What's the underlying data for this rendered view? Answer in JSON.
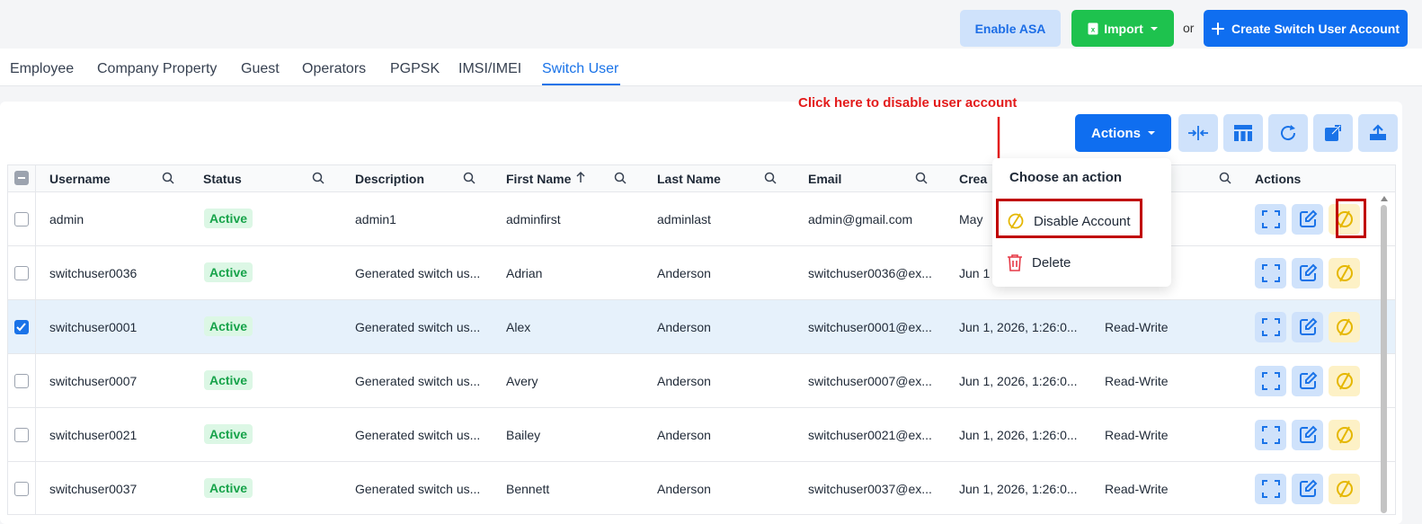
{
  "toolbar": {
    "enable_asa": "Enable ASA",
    "import": "Import",
    "or": "or",
    "create": "Create Switch User Account"
  },
  "tabs": [
    {
      "label": "Employee"
    },
    {
      "label": "Company Property"
    },
    {
      "label": "Guest"
    },
    {
      "label": "Operators"
    },
    {
      "label": "PGPSK"
    },
    {
      "label": "IMSI/IMEI"
    },
    {
      "label": "Switch User",
      "active": true
    }
  ],
  "annotation": "Click here to disable user account",
  "actions_button": "Actions",
  "table": {
    "columns": [
      "Username",
      "Status",
      "Description",
      "First Name",
      "Last Name",
      "Email",
      "Crea",
      "Actions"
    ],
    "rows": [
      {
        "username": "admin",
        "status": "Active",
        "description": "admin1",
        "first": "adminfirst",
        "last": "adminlast",
        "email": "admin@gmail.com",
        "created": "May",
        "role": "",
        "checked": false
      },
      {
        "username": "switchuser0036",
        "status": "Active",
        "description": "Generated switch us...",
        "first": "Adrian",
        "last": "Anderson",
        "email": "switchuser0036@ex...",
        "created": "Jun 1",
        "role": "",
        "checked": false
      },
      {
        "username": "switchuser0001",
        "status": "Active",
        "description": "Generated switch us...",
        "first": "Alex",
        "last": "Anderson",
        "email": "switchuser0001@ex...",
        "created": "Jun 1, 2026, 1:26:0...",
        "role": "Read-Write",
        "checked": true
      },
      {
        "username": "switchuser0007",
        "status": "Active",
        "description": "Generated switch us...",
        "first": "Avery",
        "last": "Anderson",
        "email": "switchuser0007@ex...",
        "created": "Jun 1, 2026, 1:26:0...",
        "role": "Read-Write",
        "checked": false
      },
      {
        "username": "switchuser0021",
        "status": "Active",
        "description": "Generated switch us...",
        "first": "Bailey",
        "last": "Anderson",
        "email": "switchuser0021@ex...",
        "created": "Jun 1, 2026, 1:26:0...",
        "role": "Read-Write",
        "checked": false
      },
      {
        "username": "switchuser0037",
        "status": "Active",
        "description": "Generated switch us...",
        "first": "Bennett",
        "last": "Anderson",
        "email": "switchuser0037@ex...",
        "created": "Jun 1, 2026, 1:26:0...",
        "role": "Read-Write",
        "checked": false
      }
    ]
  },
  "dropdown": {
    "title": "Choose an action",
    "items": [
      {
        "label": "Disable Account",
        "icon": "disable-icon"
      },
      {
        "label": "Delete",
        "icon": "trash-icon"
      }
    ]
  },
  "colors": {
    "primary": "#0f6ef0",
    "success": "#1ec24e",
    "annotation": "#e31b1b",
    "highlight_box": "#c00000"
  }
}
